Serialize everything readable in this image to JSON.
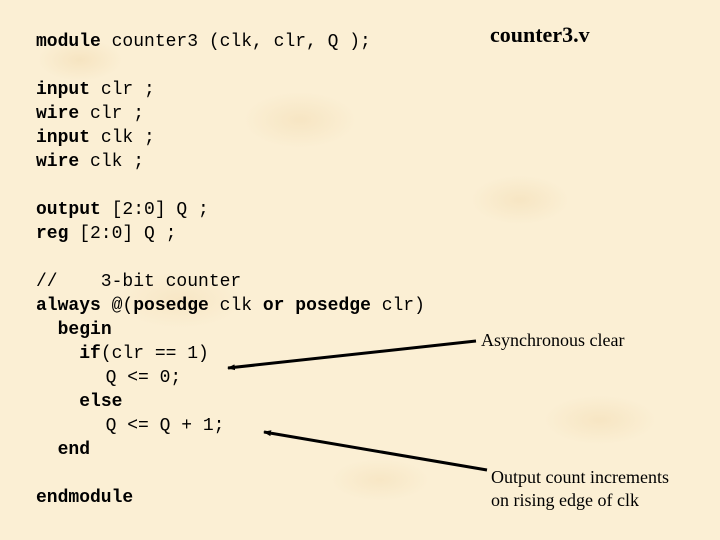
{
  "slide": {
    "title": "counter3.v",
    "annotations": {
      "async_clear": "Asynchronous clear",
      "increment_line1": "Output count increments",
      "increment_line2": "on rising edge of clk"
    },
    "code_lines": [
      {
        "indent": "",
        "kw": "module",
        "rest": " counter3 (clk, clr, Q );"
      },
      {
        "indent": "",
        "kw": "input",
        "rest": " clr ;"
      },
      {
        "indent": "",
        "kw": "wire",
        "rest": " clr ;"
      },
      {
        "indent": "",
        "kw": "input",
        "rest": " clk ;"
      },
      {
        "indent": "",
        "kw": "wire",
        "rest": " clk ;"
      },
      {
        "indent": "",
        "kw": "output",
        "rest": " [2:0] Q ;"
      },
      {
        "indent": "",
        "kw": "reg",
        "rest": " [2:0] Q ;"
      },
      {
        "indent": "",
        "kw": "",
        "rest": "//    3-bit counter"
      },
      {
        "indent": "",
        "kw": "always",
        "rest": " @(",
        "kw2": "posedge",
        "rest2": " clk ",
        "kw3": "or",
        "rest3": " ",
        "kw4": "posedge",
        "rest4": " clr)"
      },
      {
        "indent": "  ",
        "kw": "begin",
        "rest": ""
      },
      {
        "indent": "    ",
        "kw": "if",
        "rest": "(clr == 1)"
      },
      {
        "indent": "       ",
        "kw": "",
        "rest": "Q <= 0;"
      },
      {
        "indent": "    ",
        "kw": "else",
        "rest": ""
      },
      {
        "indent": "       ",
        "kw": "",
        "rest": "Q <= Q + 1;"
      },
      {
        "indent": "  ",
        "kw": "end",
        "rest": ""
      },
      {
        "indent": "",
        "kw": "endmodule",
        "rest": ""
      }
    ]
  }
}
